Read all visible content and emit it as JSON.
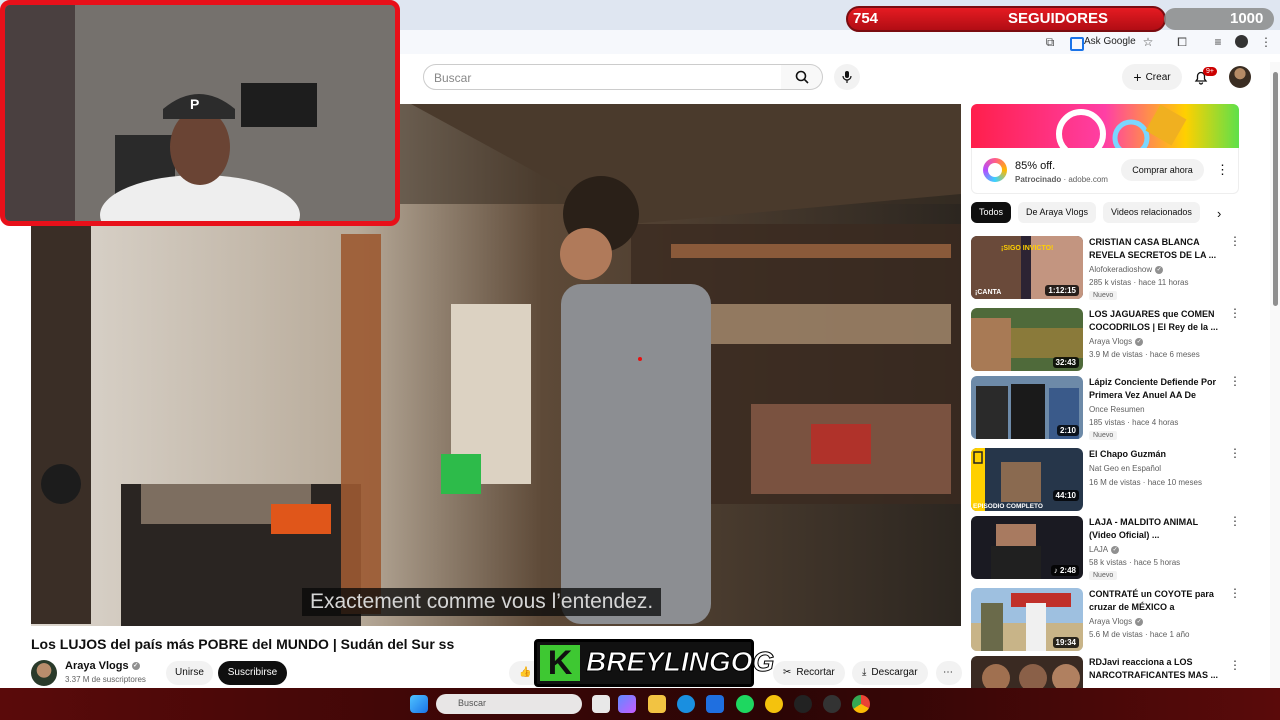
{
  "browser": {
    "ask_google": "Ask Google"
  },
  "header": {
    "search_placeholder": "Buscar",
    "create_label": "Crear",
    "notifications_badge": "9+"
  },
  "video": {
    "subtitle": "Exactement comme vous l’entendez.",
    "title": "Los LUJOS del país más POBRE del MUNDO | Sudán del Sur ss",
    "channel": "Araya Vlogs",
    "subscribers": "3.37 M de suscriptores",
    "join": "Unirse",
    "subscribe": "Suscribirse",
    "clip": "Recortar",
    "download": "Descargar"
  },
  "ad": {
    "title": "85% off.",
    "sponsored": "Patrocinado",
    "domain": "adobe.com",
    "cta": "Comprar ahora"
  },
  "chips": [
    "Todos",
    "De Araya Vlogs",
    "Videos relacionados"
  ],
  "related": [
    {
      "title": "CRISTIAN CASA BLANCA REVELA SECRETOS DE LA ...",
      "channel": "Alofokeradioshow",
      "meta": "285 k vistas · hace 11 horas",
      "duration": "1:12:15",
      "badge": "Nuevo"
    },
    {
      "title": "LOS JAGUARES que COMEN COCODRILOS | El Rey de la ...",
      "channel": "Araya Vlogs",
      "meta": "3.9 M de vistas · hace 6 meses",
      "duration": "32:43",
      "badge": ""
    },
    {
      "title": "Lápiz Conciente Defiende Por Primera Vez Anuel AA De Brya...",
      "channel": "Once Resumen",
      "meta": "185 vistas · hace 4 horas",
      "duration": "2:10",
      "badge": "Nuevo"
    },
    {
      "title": "El Chapo Guzmán",
      "channel": "Nat Geo en Español",
      "meta": "16 M de vistas · hace 10 meses",
      "duration": "44:10",
      "badge": ""
    },
    {
      "title": "LAJA - MALDITO ANIMAL (Video Oficial) ...",
      "channel": "LAJA",
      "meta": "58 k vistas · hace 5 horas",
      "duration": "2:48",
      "badge": "Nuevo"
    },
    {
      "title": "CONTRATÉ un COYOTE para cruzar de MÉXICO a ESTADOS...",
      "channel": "Araya Vlogs",
      "meta": "5.6 M de vistas · hace 1 año",
      "duration": "19:34",
      "badge": ""
    },
    {
      "title": "RDJavi reacciona a LOS NARCOTRAFICANTES MAS ...",
      "channel": "",
      "meta": "",
      "duration": "",
      "badge": ""
    }
  ],
  "overlay": {
    "followers_count": "754",
    "followers_label": "SEGUIDORES",
    "followers_goal": "1000",
    "followers_progress": 0.754,
    "streamer_logo": "BREYLINGOG",
    "logo_letter": "K"
  },
  "taskbar": {
    "search_placeholder": "Buscar"
  },
  "thumb_texts": {
    "t1": "¡SIGO INVICTO!",
    "t1b": "¡CANTA",
    "t4": "EPISODIO COMPLETO"
  },
  "colors": {
    "youtube_red": "#cc0000",
    "overlay_red": "#e51b22",
    "logo_green": "#3ec832"
  }
}
